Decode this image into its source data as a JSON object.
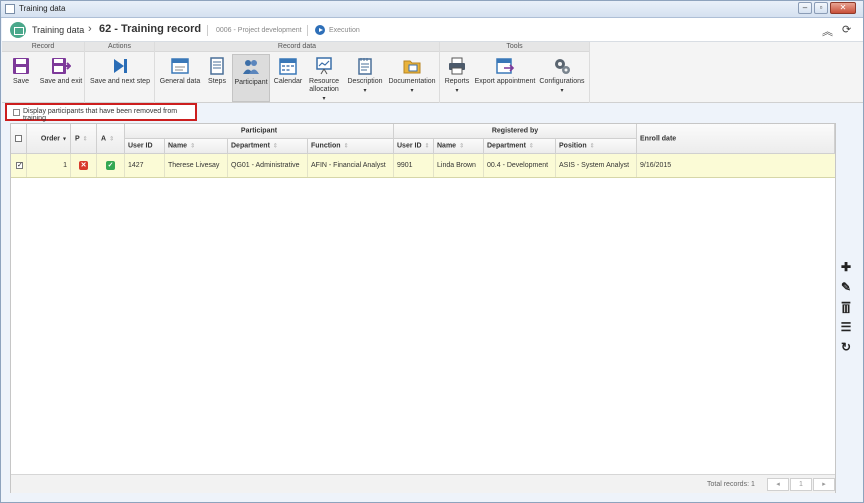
{
  "window": {
    "title": "Training data"
  },
  "header": {
    "app_name": "Training data",
    "record_title": "62 - Training record",
    "project": "0006 - Project development",
    "status": "Execution"
  },
  "ribbon": {
    "groups": {
      "record": "Record",
      "actions": "Actions",
      "record_data": "Record data",
      "tools": "Tools"
    },
    "buttons": {
      "save": "Save",
      "save_exit": "Save and exit",
      "save_next": "Save and next step",
      "general_data": "General data",
      "steps": "Steps",
      "participant": "Participant",
      "calendar": "Calendar",
      "resource_allocation_1": "Resource",
      "resource_allocation_2": "allocation",
      "description": "Description",
      "documentation": "Documentation",
      "reports": "Reports",
      "export_appointment": "Export appointment",
      "configurations": "Configurations"
    }
  },
  "filter": {
    "label": "Display participants that have been removed from training"
  },
  "grid": {
    "headers": {
      "order": "Order",
      "p": "P",
      "a": "A",
      "participant_group": "Participant",
      "registered_by_group": "Registered by",
      "enroll_date": "Enroll date",
      "user_id": "User ID",
      "name": "Name",
      "department": "Department",
      "function": "Function",
      "reg_user_id": "User ID",
      "reg_name": "Name",
      "reg_department": "Department",
      "position": "Position"
    },
    "rows": [
      {
        "order": "1",
        "user_id": "1427",
        "name": "Therese Livesay",
        "department": "QG01 - Administrative",
        "function": "AFIN - Financial Analyst",
        "reg_user_id": "9901",
        "reg_name": "Linda Brown",
        "reg_department": "00.4 - Development",
        "position": "ASIS - System Analyst",
        "enroll_date": "9/16/2015"
      }
    ],
    "footer": {
      "total": "Total records: 1",
      "page": "1"
    }
  },
  "icons": {
    "save": "save-icon",
    "save_exit": "save-exit-icon",
    "next": "play-next-icon",
    "general_data": "window-icon",
    "steps": "document-icon",
    "participant": "people-icon",
    "calendar": "calendar-icon",
    "resource": "presentation-icon",
    "description": "notepad-icon",
    "documentation": "folder-icon",
    "reports": "printer-icon",
    "export": "calendar-export-icon",
    "configurations": "gears-icon",
    "add": "plus-icon",
    "edit": "pencil-icon",
    "delete": "trash-icon",
    "list": "list-icon",
    "refresh": "refresh-icon"
  },
  "colors": {
    "accent": "#7e3a9a",
    "selection": "#fbfbd6",
    "highlight_border": "#cc1e1e"
  }
}
